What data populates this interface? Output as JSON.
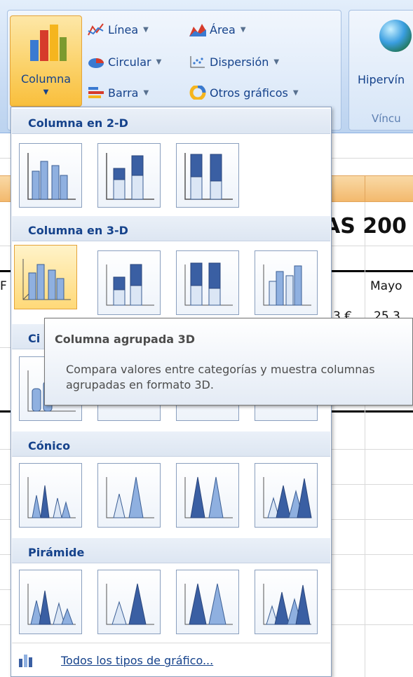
{
  "ribbon": {
    "column_button": {
      "label": "Columna",
      "icon": "column-chart-icon"
    },
    "buttons": [
      {
        "label": "Línea",
        "icon": "line-chart-icon"
      },
      {
        "label": "Área",
        "icon": "area-chart-icon"
      },
      {
        "label": "Circular",
        "icon": "pie-chart-icon"
      },
      {
        "label": "Dispersión",
        "icon": "scatter-chart-icon"
      },
      {
        "label": "Barra",
        "icon": "bar-chart-icon"
      },
      {
        "label": "Otros gráficos",
        "icon": "donut-chart-icon"
      }
    ],
    "links": {
      "label": "Hipervín",
      "group_label": "Víncu",
      "icon": "globe-icon"
    }
  },
  "sheet": {
    "title_fragment": "AS 200",
    "header_cell": "Mayo",
    "value_fragment_1": "3 €",
    "value_fragment_2": "25.3",
    "left_fragment": "F"
  },
  "menu": {
    "sections": [
      {
        "title": "Columna en 2-D"
      },
      {
        "title": "Columna en 3-D"
      },
      {
        "title": "Ci"
      },
      {
        "title": "Cónico"
      },
      {
        "title": "Pirámide"
      }
    ],
    "all_charts_label": "Todos los tipos de gráfico...",
    "selected_tile": "column-3d-clustered"
  },
  "tooltip": {
    "title": "Columna agrupada 3D",
    "description": "Compara valores entre categorías y muestra columnas agrupadas en formato 3D."
  },
  "colors": {
    "accent": "#15428b",
    "hover": "#ffd978",
    "ribbon": "#c6daf3"
  }
}
